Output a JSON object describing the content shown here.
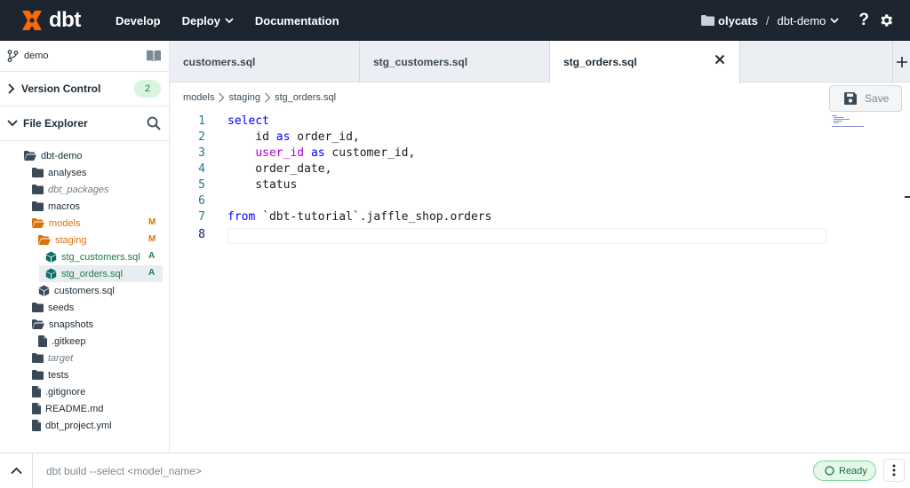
{
  "topbar": {
    "logo_text": "dbt",
    "nav": [
      {
        "label": "Develop"
      },
      {
        "label": "Deploy"
      },
      {
        "label": "Documentation"
      }
    ],
    "account": "olycats",
    "separator": "/",
    "project": "dbt-demo"
  },
  "sidebar": {
    "branch": "demo",
    "version_control": {
      "label": "Version Control",
      "badge": "2"
    },
    "file_explorer": {
      "label": "File Explorer"
    },
    "tree": [
      {
        "label": "dbt-demo",
        "icon": "folder-open-icon",
        "status": ""
      },
      {
        "label": "analyses",
        "icon": "folder-icon",
        "status": ""
      },
      {
        "label": "dbt_packages",
        "icon": "folder-icon",
        "status": ""
      },
      {
        "label": "macros",
        "icon": "folder-icon",
        "status": ""
      },
      {
        "label": "models",
        "icon": "folder-open-icon",
        "status": "M"
      },
      {
        "label": "staging",
        "icon": "folder-open-icon",
        "status": "M"
      },
      {
        "label": "stg_customers.sql",
        "icon": "model-cube-icon",
        "status": "A"
      },
      {
        "label": "stg_orders.sql",
        "icon": "model-cube-icon",
        "status": "A"
      },
      {
        "label": "customers.sql",
        "icon": "model-cube-icon",
        "status": ""
      },
      {
        "label": "seeds",
        "icon": "folder-icon",
        "status": ""
      },
      {
        "label": "snapshots",
        "icon": "folder-open-icon",
        "status": ""
      },
      {
        "label": ".gitkeep",
        "icon": "file-icon",
        "status": ""
      },
      {
        "label": "target",
        "icon": "folder-icon",
        "status": ""
      },
      {
        "label": "tests",
        "icon": "folder-icon",
        "status": ""
      },
      {
        "label": ".gitignore",
        "icon": "file-icon",
        "status": ""
      },
      {
        "label": "README.md",
        "icon": "file-icon",
        "status": ""
      },
      {
        "label": "dbt_project.yml",
        "icon": "file-icon",
        "status": ""
      }
    ]
  },
  "tabs": [
    {
      "label": "customers.sql"
    },
    {
      "label": "stg_customers.sql"
    },
    {
      "label": "stg_orders.sql",
      "active": true
    }
  ],
  "breadcrumb": [
    "models",
    "staging",
    "stg_orders.sql"
  ],
  "save_label": "Save",
  "editor": {
    "line_numbers": [
      "1",
      "2",
      "3",
      "4",
      "5",
      "6",
      "7",
      "8"
    ],
    "current_line": "8"
  },
  "bottombar": {
    "command_placeholder": "dbt build --select <model_name>",
    "status": "Ready"
  },
  "colors": {
    "topbar_bg": "#1c2530",
    "brand_orange": "#fe6703",
    "modified": "#d9720c",
    "added": "#217a4c",
    "ready_green": "#7fd59a"
  }
}
